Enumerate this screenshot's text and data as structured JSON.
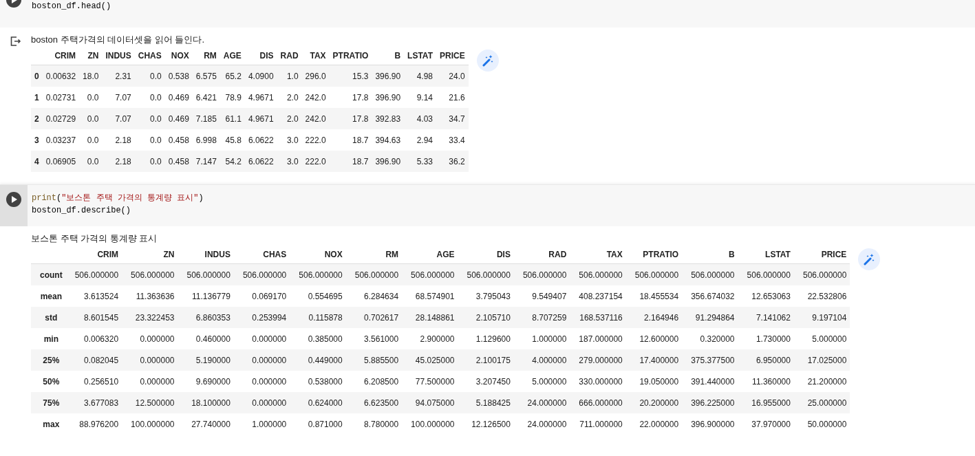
{
  "cells": [
    {
      "code": [
        [
          {
            "kind": "plain",
            "text": "boston_df.head()"
          }
        ]
      ],
      "output_text": "boston 주택가격의 데이터셋을 읽어 들인다.",
      "show_output_icon": true,
      "table": {
        "columns": [
          "CRIM",
          "ZN",
          "INDUS",
          "CHAS",
          "NOX",
          "RM",
          "AGE",
          "DIS",
          "RAD",
          "TAX",
          "PTRATIO",
          "B",
          "LSTAT",
          "PRICE"
        ],
        "rows": [
          {
            "index": "0",
            "cells": [
              "0.00632",
              "18.0",
              "2.31",
              "0.0",
              "0.538",
              "6.575",
              "65.2",
              "4.0900",
              "1.0",
              "296.0",
              "15.3",
              "396.90",
              "4.98",
              "24.0"
            ]
          },
          {
            "index": "1",
            "cells": [
              "0.02731",
              "0.0",
              "7.07",
              "0.0",
              "0.469",
              "6.421",
              "78.9",
              "4.9671",
              "2.0",
              "242.0",
              "17.8",
              "396.90",
              "9.14",
              "21.6"
            ]
          },
          {
            "index": "2",
            "cells": [
              "0.02729",
              "0.0",
              "7.07",
              "0.0",
              "0.469",
              "7.185",
              "61.1",
              "4.9671",
              "2.0",
              "242.0",
              "17.8",
              "392.83",
              "4.03",
              "34.7"
            ]
          },
          {
            "index": "3",
            "cells": [
              "0.03237",
              "0.0",
              "2.18",
              "0.0",
              "0.458",
              "6.998",
              "45.8",
              "6.0622",
              "3.0",
              "222.0",
              "18.7",
              "394.63",
              "2.94",
              "33.4"
            ]
          },
          {
            "index": "4",
            "cells": [
              "0.06905",
              "0.0",
              "2.18",
              "0.0",
              "0.458",
              "7.147",
              "54.2",
              "6.0622",
              "3.0",
              "222.0",
              "18.7",
              "396.90",
              "5.33",
              "36.2"
            ]
          }
        ]
      }
    },
    {
      "code": [
        [
          {
            "kind": "builtin",
            "text": "print"
          },
          {
            "kind": "plain",
            "text": "("
          },
          {
            "kind": "string",
            "text": "\"보스톤 주택 가격의 통계량 표시\""
          },
          {
            "kind": "plain",
            "text": ")"
          }
        ],
        [
          {
            "kind": "plain",
            "text": "boston_df.describe()"
          }
        ]
      ],
      "output_text": "보스톤 주택 가격의 통계량 표시",
      "show_output_icon": false,
      "table": {
        "columns": [
          "CRIM",
          "ZN",
          "INDUS",
          "CHAS",
          "NOX",
          "RM",
          "AGE",
          "DIS",
          "RAD",
          "TAX",
          "PTRATIO",
          "B",
          "LSTAT",
          "PRICE"
        ],
        "rows": [
          {
            "index": "count",
            "cells": [
              "506.000000",
              "506.000000",
              "506.000000",
              "506.000000",
              "506.000000",
              "506.000000",
              "506.000000",
              "506.000000",
              "506.000000",
              "506.000000",
              "506.000000",
              "506.000000",
              "506.000000",
              "506.000000"
            ]
          },
          {
            "index": "mean",
            "cells": [
              "3.613524",
              "11.363636",
              "11.136779",
              "0.069170",
              "0.554695",
              "6.284634",
              "68.574901",
              "3.795043",
              "9.549407",
              "408.237154",
              "18.455534",
              "356.674032",
              "12.653063",
              "22.532806"
            ]
          },
          {
            "index": "std",
            "cells": [
              "8.601545",
              "23.322453",
              "6.860353",
              "0.253994",
              "0.115878",
              "0.702617",
              "28.148861",
              "2.105710",
              "8.707259",
              "168.537116",
              "2.164946",
              "91.294864",
              "7.141062",
              "9.197104"
            ]
          },
          {
            "index": "min",
            "cells": [
              "0.006320",
              "0.000000",
              "0.460000",
              "0.000000",
              "0.385000",
              "3.561000",
              "2.900000",
              "1.129600",
              "1.000000",
              "187.000000",
              "12.600000",
              "0.320000",
              "1.730000",
              "5.000000"
            ]
          },
          {
            "index": "25%",
            "cells": [
              "0.082045",
              "0.000000",
              "5.190000",
              "0.000000",
              "0.449000",
              "5.885500",
              "45.025000",
              "2.100175",
              "4.000000",
              "279.000000",
              "17.400000",
              "375.377500",
              "6.950000",
              "17.025000"
            ]
          },
          {
            "index": "50%",
            "cells": [
              "0.256510",
              "0.000000",
              "9.690000",
              "0.000000",
              "0.538000",
              "6.208500",
              "77.500000",
              "3.207450",
              "5.000000",
              "330.000000",
              "19.050000",
              "391.440000",
              "11.360000",
              "21.200000"
            ]
          },
          {
            "index": "75%",
            "cells": [
              "3.677083",
              "12.500000",
              "18.100000",
              "0.000000",
              "0.624000",
              "6.623500",
              "94.075000",
              "5.188425",
              "24.000000",
              "666.000000",
              "20.200000",
              "396.225000",
              "16.955000",
              "25.000000"
            ]
          },
          {
            "index": "max",
            "cells": [
              "88.976200",
              "100.000000",
              "27.740000",
              "1.000000",
              "0.871000",
              "8.780000",
              "100.000000",
              "12.126500",
              "24.000000",
              "711.000000",
              "22.000000",
              "396.900000",
              "37.970000",
              "50.000000"
            ]
          }
        ]
      }
    }
  ]
}
